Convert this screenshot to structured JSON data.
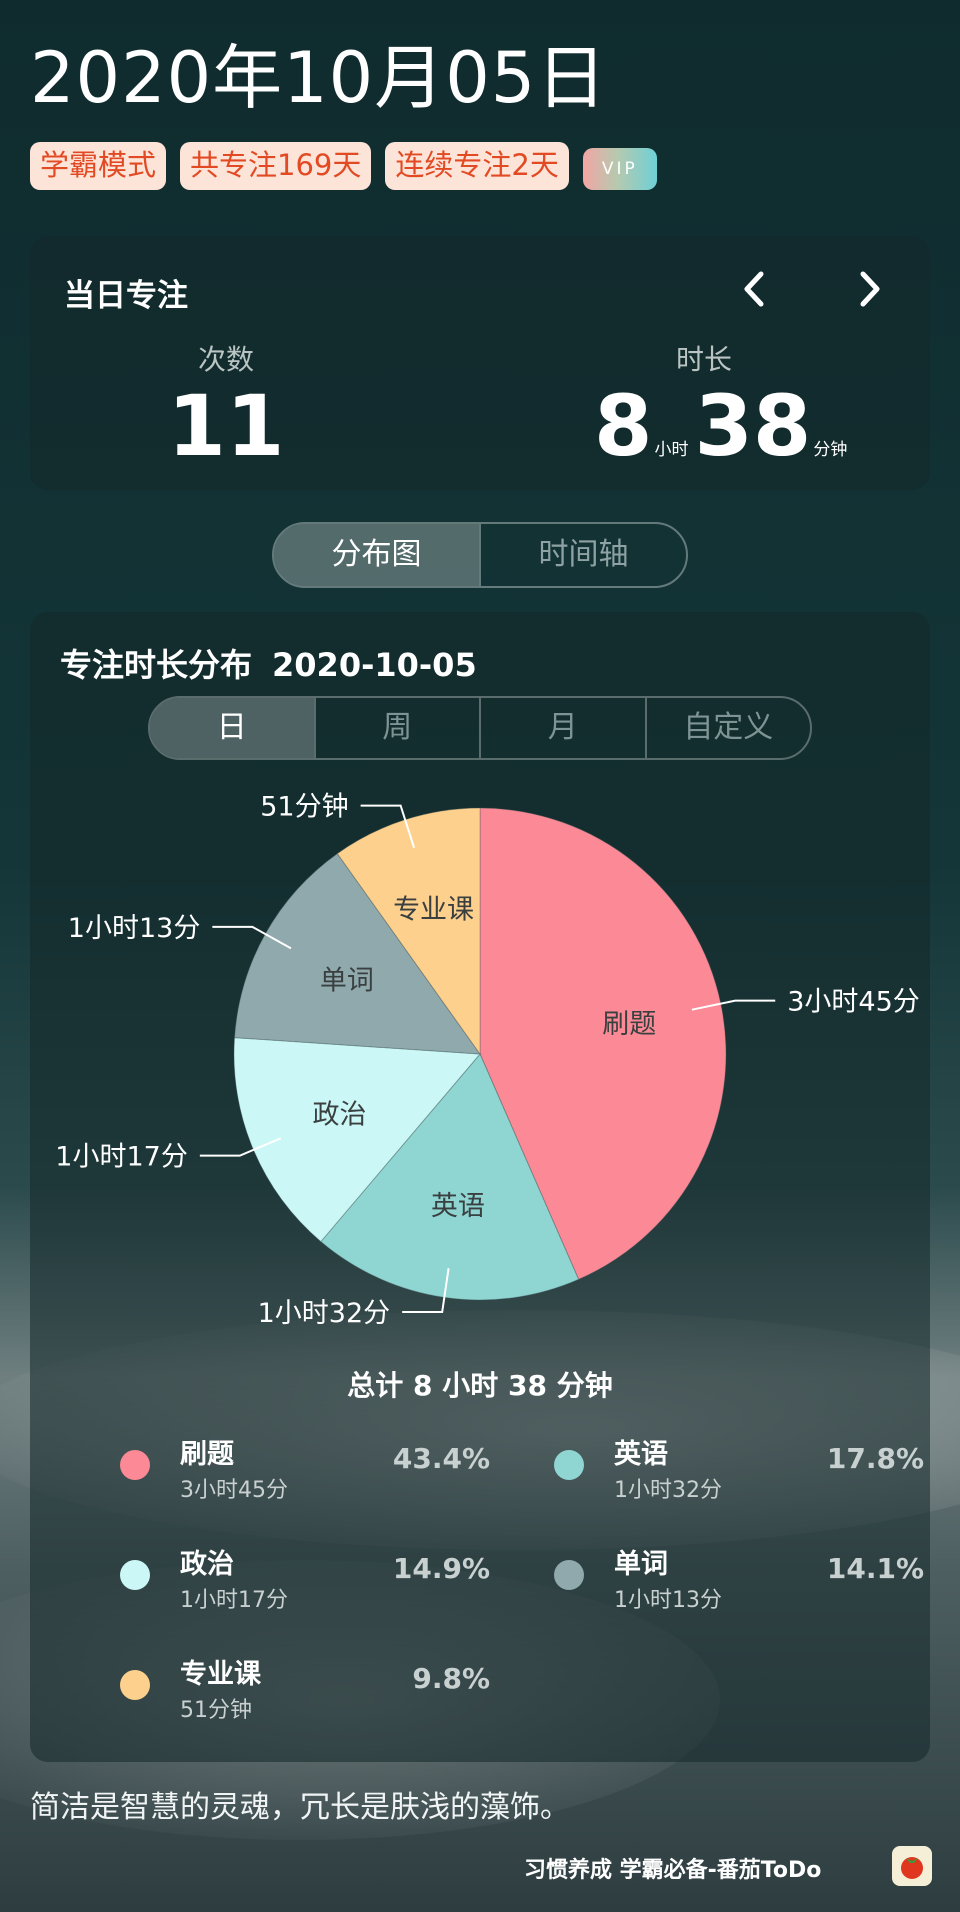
{
  "header": {
    "date": "2020年10月05日",
    "badges": [
      "学霸模式",
      "共专注169天",
      "连续专注2天"
    ],
    "vip": "VIP"
  },
  "daily": {
    "title": "当日专注",
    "count_label": "次数",
    "count_value": "11",
    "duration_label": "时长",
    "hours": "8",
    "hours_unit": "小时",
    "minutes": "38",
    "minutes_unit": "分钟"
  },
  "view_tabs": [
    "分布图",
    "时间轴"
  ],
  "distribution": {
    "title": "专注时长分布",
    "date": "2020-10-05",
    "periods": [
      "日",
      "周",
      "月",
      "自定义"
    ],
    "total": "总计 8 小时 38 分钟"
  },
  "chart_data": {
    "type": "pie",
    "slices": [
      {
        "name": "刷题",
        "minutes": 225,
        "time": "3小时45分",
        "percent": "43.4%",
        "color": "#fb8a96"
      },
      {
        "name": "英语",
        "minutes": 92,
        "time": "1小时32分",
        "percent": "17.8%",
        "color": "#8fd5d2"
      },
      {
        "name": "政治",
        "minutes": 77,
        "time": "1小时17分",
        "percent": "14.9%",
        "color": "#cbf8f6"
      },
      {
        "name": "单词",
        "minutes": 73,
        "time": "1小时13分",
        "percent": "14.1%",
        "color": "#8fa9ad"
      },
      {
        "name": "专业课",
        "minutes": 51,
        "time": "51分钟",
        "percent": "9.8%",
        "color": "#fdd18d"
      }
    ]
  },
  "footer": {
    "quote": "简洁是智慧的灵魂，冗长是肤浅的藻饰。",
    "brand": "习惯养成 学霸必备-番茄ToDo"
  }
}
